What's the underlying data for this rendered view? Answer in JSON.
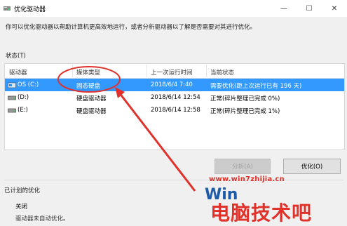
{
  "window": {
    "title": "优化驱动器",
    "controls": [
      "minimize",
      "maximize",
      "close"
    ]
  },
  "description": "你可以优化驱动器以帮助计算机更高效地运行，或者分析驱动器以了解是否需要对其进行优化。",
  "status": {
    "label": "状态(T)",
    "columns": [
      "驱动器",
      "媒体类型",
      "上一次运行时间",
      "当前状态"
    ],
    "rows": [
      {
        "drive": "OS (C:)",
        "media": "固态硬盘",
        "last_run": "2018/6/4 7:40",
        "state": "需要优化(距上次运行已有 196 天)",
        "selected": true
      },
      {
        "drive": "(D:)",
        "media": "硬盘驱动器",
        "last_run": "2018/6/14 12:54",
        "state": "正常(碎片整理已完成 0%)",
        "selected": false
      },
      {
        "drive": "(E:)",
        "media": "硬盘驱动器",
        "last_run": "2018/6/14 12:58",
        "state": "正常(碎片整理已完成 1%)",
        "selected": false
      }
    ]
  },
  "buttons": {
    "analyze": "分析(A)",
    "optimize": "优化(O)"
  },
  "scheduled": {
    "label": "已计划的优化",
    "state": "关闭",
    "desc": "驱动器未自动优化。"
  },
  "watermark": {
    "url": "www.win7zhijia.cn",
    "text": "电脑技术吧"
  },
  "colors": {
    "selection": "#3399ff",
    "annotation": "#e0312b"
  }
}
